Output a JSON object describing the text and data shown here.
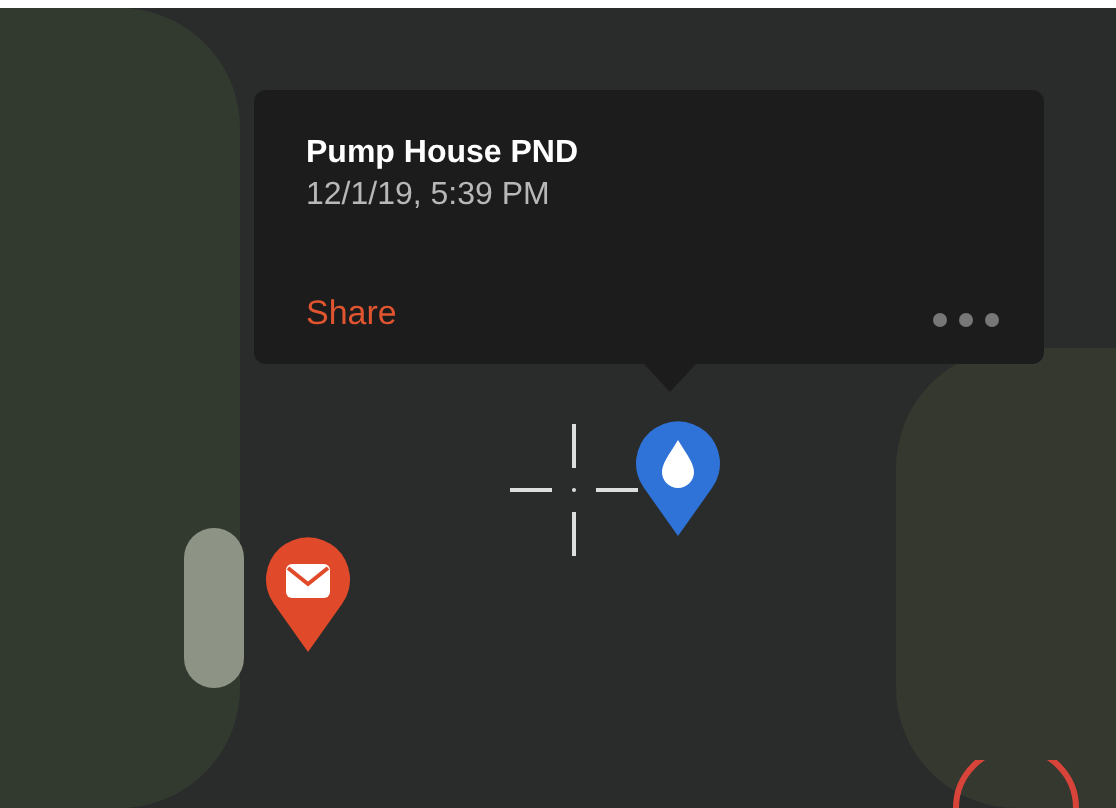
{
  "popup": {
    "title": "Pump House PND",
    "timestamp": "12/1/19, 5:39 PM",
    "share_action": "Share"
  }
}
